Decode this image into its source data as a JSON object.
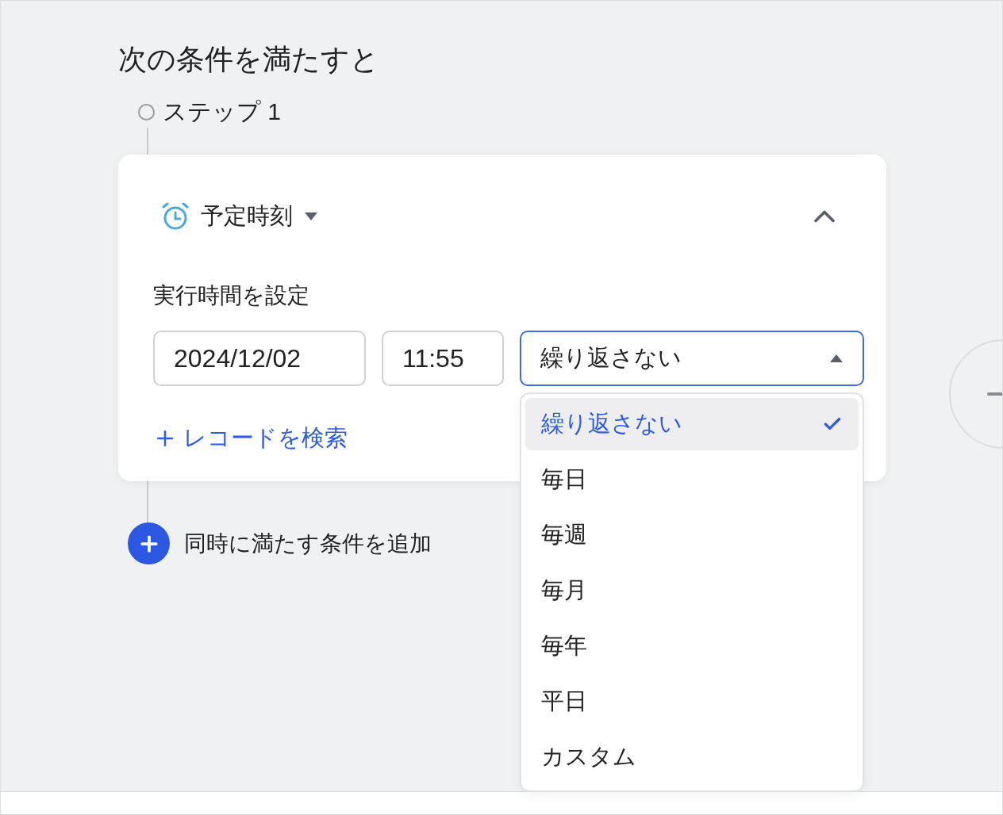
{
  "heading": "次の条件を満たすと",
  "step": {
    "label": "ステップ 1"
  },
  "condition": {
    "type_label": "予定時刻",
    "expanded": true,
    "section_label": "実行時間を設定",
    "date": "2024/12/02",
    "time": "11:55",
    "repeat": {
      "value": "繰り返さない",
      "open": true,
      "options": [
        {
          "label": "繰り返さない",
          "selected": true
        },
        {
          "label": "毎日",
          "selected": false
        },
        {
          "label": "毎週",
          "selected": false
        },
        {
          "label": "毎月",
          "selected": false
        },
        {
          "label": "毎年",
          "selected": false
        },
        {
          "label": "平日",
          "selected": false
        },
        {
          "label": "カスタム",
          "selected": false
        }
      ]
    },
    "search_link": "レコードを検索"
  },
  "add_condition": "同時に満たす条件を追加"
}
